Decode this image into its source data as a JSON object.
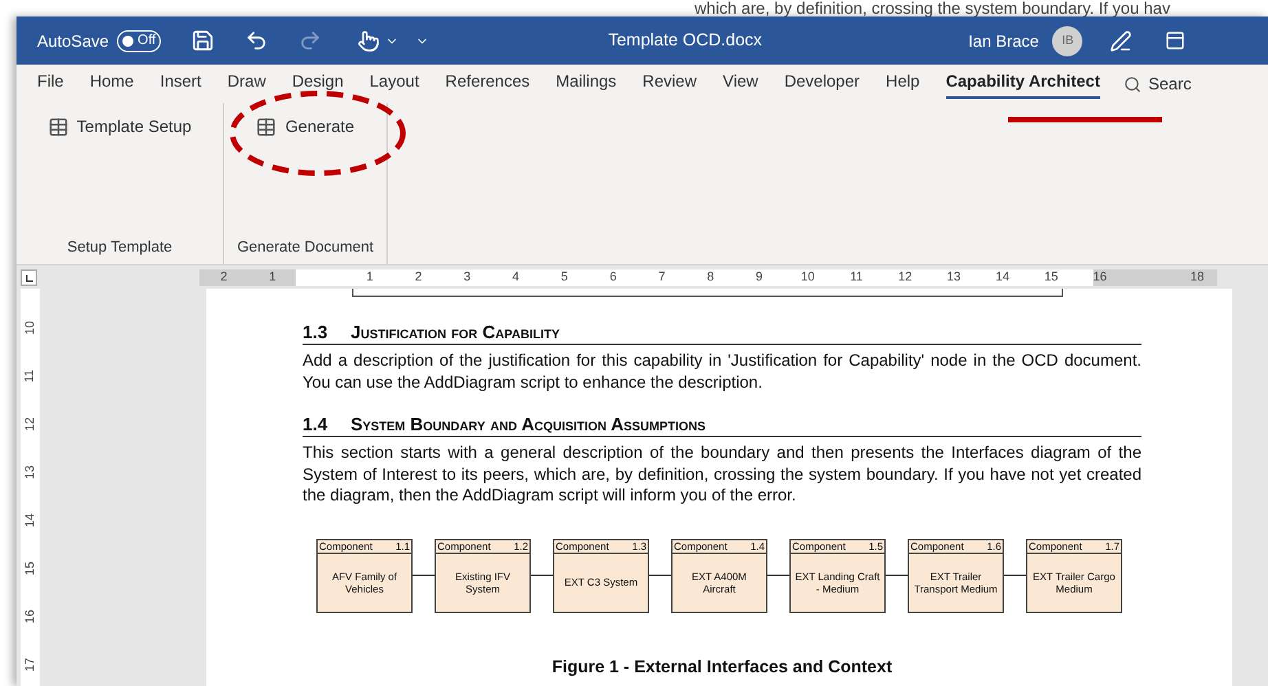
{
  "background_document": {
    "text": "which are, by definition, crossing the system boundary. If you hav"
  },
  "title_bar": {
    "autosave_label": "AutoSave",
    "autosave": {
      "label": "Off",
      "on": false
    },
    "title": "Template OCD.docx",
    "user_name": "Ian Brace",
    "user_initials": "IB"
  },
  "tabs": [
    {
      "label": "File",
      "selected": false
    },
    {
      "label": "Home",
      "selected": false
    },
    {
      "label": "Insert",
      "selected": false
    },
    {
      "label": "Draw",
      "selected": false
    },
    {
      "label": "Design",
      "selected": false
    },
    {
      "label": "Layout",
      "selected": false
    },
    {
      "label": "References",
      "selected": false
    },
    {
      "label": "Mailings",
      "selected": false
    },
    {
      "label": "Review",
      "selected": false
    },
    {
      "label": "View",
      "selected": false
    },
    {
      "label": "Developer",
      "selected": false
    },
    {
      "label": "Help",
      "selected": false
    },
    {
      "label": "Capability Architect",
      "selected": true
    }
  ],
  "search": {
    "label": "Searc"
  },
  "ribbon_groups": [
    {
      "label": "Setup Template",
      "buttons": [
        "Template Setup"
      ]
    },
    {
      "label": "Generate Document",
      "buttons": [
        "Generate"
      ]
    }
  ],
  "ruler": {
    "left_labels": [
      "2",
      "1"
    ],
    "labels": [
      "1",
      "2",
      "3",
      "4",
      "5",
      "6",
      "7",
      "8",
      "9",
      "10",
      "11",
      "12",
      "13",
      "14",
      "15",
      "16"
    ],
    "right_labels": [
      "18"
    ],
    "vertical_labels": [
      "10",
      "11",
      "12",
      "13",
      "14",
      "15",
      "16",
      "17"
    ]
  },
  "document": {
    "sections": [
      {
        "number": "1.3",
        "title": "Justification for Capability",
        "paragraph": "Add a description of the justification for this capability in 'Justification for Capability' node in the OCD document. You can use the AddDiagram script to enhance the description."
      },
      {
        "number": "1.4",
        "title": "System Boundary and Acquisition Assumptions",
        "paragraph": "This section starts with a general description of the boundary and then presents the Interfaces diagram of the System of Interest to its peers, which are, by definition, crossing the system boundary. If you have not yet created the diagram, then the AddDiagram script will inform you of the error."
      }
    ],
    "diagram": {
      "components": [
        {
          "stereotype": "Component",
          "id": "1.1",
          "name": "AFV Family of Vehicles"
        },
        {
          "stereotype": "Component",
          "id": "1.2",
          "name": "Existing IFV System"
        },
        {
          "stereotype": "Component",
          "id": "1.3",
          "name": "EXT C3 System"
        },
        {
          "stereotype": "Component",
          "id": "1.4",
          "name": "EXT A400M Aircraft"
        },
        {
          "stereotype": "Component",
          "id": "1.5",
          "name": "EXT Landing Craft - Medium"
        },
        {
          "stereotype": "Component",
          "id": "1.6",
          "name": "EXT Trailer Transport Medium"
        },
        {
          "stereotype": "Component",
          "id": "1.7",
          "name": "EXT Trailer Cargo Medium"
        }
      ]
    },
    "figure_caption": "Figure 1 - External Interfaces and Context"
  }
}
